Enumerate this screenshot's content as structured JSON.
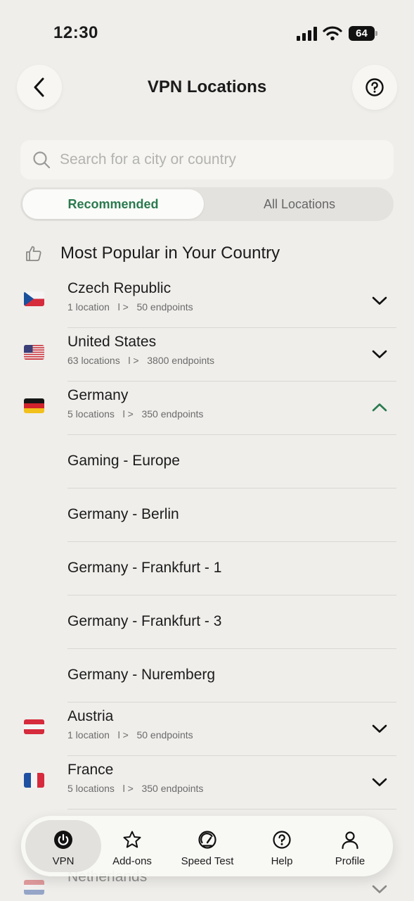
{
  "status_bar": {
    "time": "12:30",
    "battery": "64"
  },
  "header": {
    "title": "VPN Locations"
  },
  "search": {
    "placeholder": "Search for a city or country"
  },
  "segments": {
    "recommended": "Recommended",
    "all": "All Locations"
  },
  "section": {
    "title": "Most Popular in Your Country"
  },
  "countries": [
    {
      "name": "Czech Republic",
      "locations": "1 location",
      "sep": "l >",
      "endpoints": "50 endpoints",
      "expanded": false
    },
    {
      "name": "United States",
      "locations": "63 locations",
      "sep": "l >",
      "endpoints": "3800 endpoints",
      "expanded": false
    },
    {
      "name": "Germany",
      "locations": "5 locations",
      "sep": "l >",
      "endpoints": "350 endpoints",
      "expanded": true
    },
    {
      "name": "Austria",
      "locations": "1 location",
      "sep": "l >",
      "endpoints": "50 endpoints",
      "expanded": false
    },
    {
      "name": "France",
      "locations": "5 locations",
      "sep": "l >",
      "endpoints": "350 endpoints",
      "expanded": false
    },
    {
      "name": "Netherlands",
      "locations": "",
      "sep": "",
      "endpoints": "",
      "expanded": false
    }
  ],
  "germany_sublocations": [
    "Gaming - Europe",
    "Germany - Berlin",
    "Germany - Frankfurt - 1",
    "Germany - Frankfurt - 3",
    "Germany - Nuremberg"
  ],
  "tabbar": {
    "vpn": "VPN",
    "addons": "Add-ons",
    "speedtest": "Speed Test",
    "help": "Help",
    "profile": "Profile"
  },
  "colors": {
    "accent": "#2a7a4e",
    "background": "#efeeeb"
  }
}
